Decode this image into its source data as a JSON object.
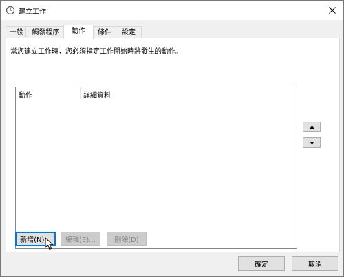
{
  "window": {
    "title": "建立工作"
  },
  "tabs": [
    {
      "label": "一般"
    },
    {
      "label": "觸發程序"
    },
    {
      "label": "動作"
    },
    {
      "label": "條件"
    },
    {
      "label": "設定"
    }
  ],
  "panel": {
    "instruction": "當您建立工作時，您必須指定工作開始時將發生的動作。",
    "columns": [
      {
        "label": "動作"
      },
      {
        "label": "詳細資料"
      }
    ]
  },
  "buttons": {
    "new": "新增(N)...",
    "edit": "編輯(E)...",
    "delete": "刪除(D)",
    "ok": "確定",
    "cancel": "取消"
  }
}
